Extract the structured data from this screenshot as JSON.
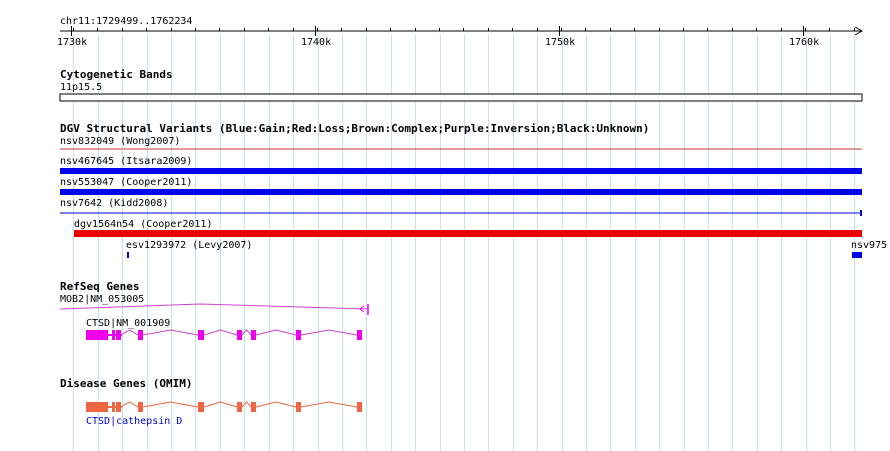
{
  "region_label": "chr11:1729499..1762234",
  "ruler": {
    "ticks": [
      "1730k",
      "1740k",
      "1750k",
      "1760k"
    ]
  },
  "tracks": {
    "cytoband": {
      "title": "Cytogenetic Bands",
      "band": "11p15.5"
    },
    "dgv": {
      "title": "DGV Structural Variants (Blue:Gain;Red:Loss;Brown:Complex;Purple:Inversion;Black:Unknown)",
      "colors": {
        "gain": "#0000ee",
        "loss": "#ee0000",
        "loss_thin": "#cc3333"
      },
      "features": [
        {
          "label": "nsv832049 (Wong2007)",
          "color": "loss_thin"
        },
        {
          "label": "nsv467645 (Itsara2009)",
          "color": "gain"
        },
        {
          "label": "nsv553047 (Cooper2011)",
          "color": "gain"
        },
        {
          "label": "nsv7642 (Kidd2008)",
          "color": "gain"
        },
        {
          "label": "dgv1564n54 (Cooper2011)",
          "color": "loss"
        },
        {
          "label": "esv1293972 (Levy2007)",
          "color": "gain"
        },
        {
          "label": "nsv975",
          "color": "gain"
        }
      ]
    },
    "refseq": {
      "title": "RefSeq Genes",
      "color": "#ee00ee",
      "line_color": "#cc44cc",
      "genes": [
        {
          "label": "MOB2|NM_053005"
        },
        {
          "label": "CTSD|NM_001909"
        }
      ]
    },
    "omim": {
      "title": "Disease Genes (OMIM)",
      "color": "#ee6644",
      "gene": {
        "label": "CTSD|cathepsin D"
      }
    }
  }
}
